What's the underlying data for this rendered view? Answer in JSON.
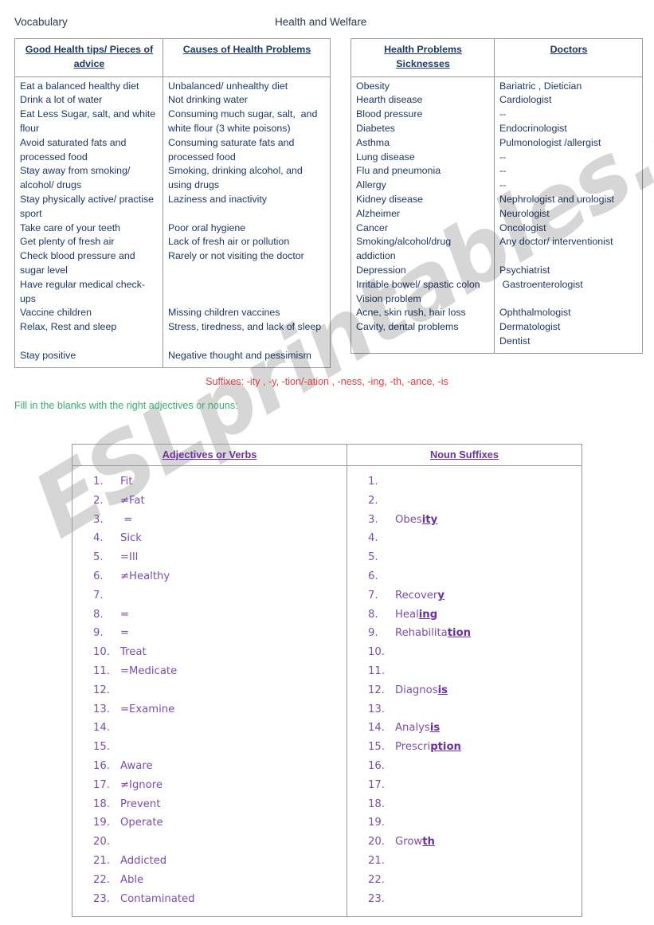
{
  "header": {
    "vocabulary_label": "Vocabulary",
    "title": "Health and Welfare"
  },
  "table_left": {
    "headers": [
      "Good Health tips/ Pieces of advice",
      "Causes of Health Problems"
    ],
    "good_health_tips": [
      "Eat a balanced healthy diet",
      "Drink a lot of water",
      "Eat Less Sugar, salt, and white flour",
      "Avoid saturated fats and processed food",
      "Stay away from smoking/ alcohol/ drugs",
      "Stay physically active/ practise sport",
      "Take care of your teeth",
      "Get plenty of fresh air",
      "Check blood pressure and sugar level",
      "Have regular medical check-ups",
      "Vaccine children",
      "Relax, Rest and sleep",
      "",
      "Stay positive"
    ],
    "causes": [
      "Unbalanced/ unhealthy diet",
      "Not drinking water",
      "Consuming much sugar, salt,  and white flour (3 white poisons)",
      "Consuming saturate fats and processed food",
      "Smoking, drinking alcohol, and using drugs",
      "Laziness and inactivity",
      "",
      "Poor oral hygiene",
      "Lack of fresh air or pollution",
      "Rarely or not visiting the doctor",
      "",
      "",
      "",
      "Missing children vaccines",
      "Stress, tiredness, and lack of sleep",
      "",
      "Negative thought and pessimism"
    ]
  },
  "table_right": {
    "headers": [
      "Health Problems Sicknesses",
      "Doctors"
    ],
    "header_lines": [
      [
        "Health Problems",
        "Sicknesses"
      ],
      [
        "Doctors"
      ]
    ],
    "sicknesses": [
      "Obesity",
      "Hearth disease",
      "Blood pressure",
      "Diabetes",
      "Asthma",
      "Lung disease",
      "Flu and pneumonia",
      "Allergy",
      "Kidney disease",
      "Alzheimer",
      "Cancer",
      "Smoking/alcohol/drug addiction",
      "Depression",
      "Irritable bowel/ spastic colon",
      "Vision problem",
      "Acne, skin rush, hair loss",
      "Cavity, dental problems"
    ],
    "doctors": [
      "Bariatric , Dietician",
      "Cardiologist",
      "--",
      "Endocrinologist",
      "Pulmonologist /allergist",
      "--",
      "--",
      "--",
      "Nephrologist and urologist",
      "Neurologist",
      "Oncologist",
      "Any doctor/ interventionist",
      "",
      "Psychiatrist",
      " Gastroenterologist",
      "",
      "Ophthalmologist",
      "Dermatologist",
      "Dentist"
    ]
  },
  "suffixes_note": "Suffixes: -ity , -y, -tion/-ation , -ness, -ing, -th, -ance, -is",
  "instruction": "Fill in the blanks with the right adjectives or nouns:",
  "table_bottom": {
    "headers": [
      "Adjectives or Verbs",
      "Noun Suffixes"
    ],
    "adjectives_or_verbs": [
      "Fit",
      "≠Fat",
      " =",
      "Sick",
      "=Ill",
      "≠Healthy",
      "",
      "=",
      "=",
      "Treat",
      "=Medicate",
      "",
      "=Examine",
      "",
      "",
      "Aware",
      "≠Ignore",
      "Prevent",
      "Operate",
      "",
      "Addicted",
      "Able",
      "Contaminated"
    ],
    "noun_suffixes": [
      {
        "stem": "",
        "suffix": ""
      },
      {
        "stem": "",
        "suffix": ""
      },
      {
        "stem": "Obes",
        "suffix": "ity"
      },
      {
        "stem": "",
        "suffix": ""
      },
      {
        "stem": "",
        "suffix": ""
      },
      {
        "stem": "",
        "suffix": ""
      },
      {
        "stem": "Recover",
        "suffix": "y"
      },
      {
        "stem": "Heal",
        "suffix": "ing"
      },
      {
        "stem": "Rehabilita",
        "suffix": "tion"
      },
      {
        "stem": "",
        "suffix": ""
      },
      {
        "stem": "",
        "suffix": ""
      },
      {
        "stem": "Diagnos",
        "suffix": "is"
      },
      {
        "stem": "",
        "suffix": ""
      },
      {
        "stem": "Analys",
        "suffix": "is"
      },
      {
        "stem": "Prescri",
        "suffix": "ption"
      },
      {
        "stem": "",
        "suffix": ""
      },
      {
        "stem": "",
        "suffix": ""
      },
      {
        "stem": "",
        "suffix": ""
      },
      {
        "stem": "",
        "suffix": ""
      },
      {
        "stem": "Grow",
        "suffix": "th"
      },
      {
        "stem": "",
        "suffix": ""
      },
      {
        "stem": "",
        "suffix": ""
      },
      {
        "stem": "",
        "suffix": ""
      }
    ]
  },
  "watermark": {
    "text": "ESLprintables.com"
  },
  "colors": {
    "table_text": "#1f3864",
    "suffix_note": "#e03b44",
    "instruction": "#35b06a",
    "bottom_table_text": "#7b4ea8",
    "bottom_table_header": "#7030a0"
  }
}
